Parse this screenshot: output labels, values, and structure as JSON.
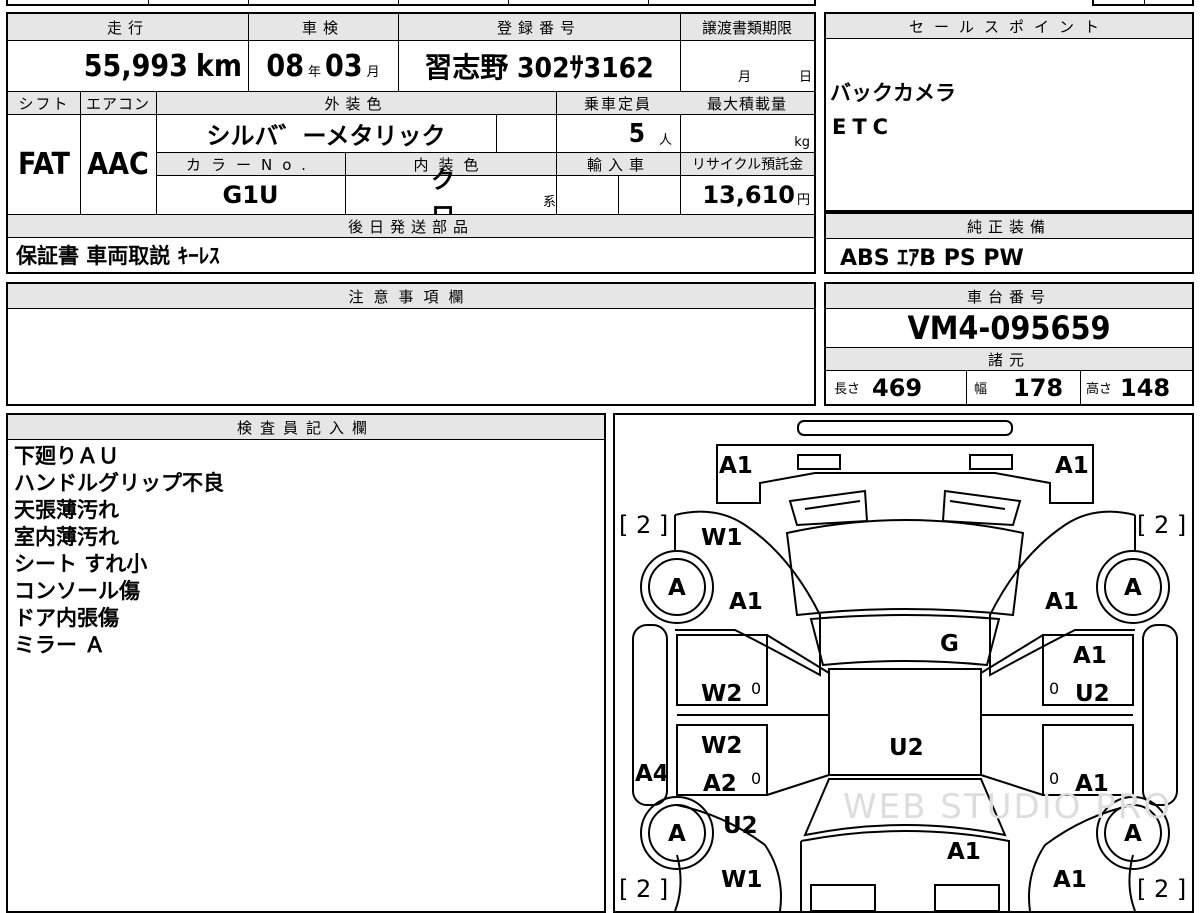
{
  "top": {
    "h_mileage": "走行",
    "mileage": "55,993",
    "mileage_unit": "km",
    "h_inspection": "車検",
    "insp_year": "08",
    "insp_year_unit": "年",
    "insp_month": "03",
    "insp_month_unit": "月",
    "h_registration": "登録番号",
    "registration": "習志野 302ｻ3162",
    "h_transfer": "譲渡書類期限",
    "transfer_month": "月",
    "transfer_day": "日"
  },
  "spec": {
    "h_shift": "シフト",
    "shift": "FAT",
    "h_aircon": "エアコン",
    "aircon": "AAC",
    "h_exterior": "外装色",
    "exterior": "シルバ゛ーメタリック",
    "h_capacity": "乗車定員",
    "capacity": "5",
    "capacity_unit": "人",
    "h_maxload": "最大積載量",
    "maxload_unit": "kg",
    "h_color_no": "カラーNo.",
    "color_no": "G1U",
    "h_interior": "内装色",
    "interior": "クロ",
    "interior_unit": "系",
    "h_import": "輸入車",
    "h_recycle": "リサイクル預託金",
    "recycle": "13,610",
    "recycle_unit": "円"
  },
  "later": {
    "header": "後日発送部品",
    "items": "保証書 車両取説 ｷｰﾚｽ"
  },
  "sales": {
    "header": "セールスポイント",
    "lines": [
      "バックカメラ",
      "ETC"
    ]
  },
  "genuine": {
    "header": "純正装備",
    "items": "ABS ｴｱB PS PW"
  },
  "notes": {
    "header": "注意事項欄"
  },
  "chassis": {
    "header": "車台番号",
    "number": "VM4-095659",
    "spec_header": "諸元",
    "len_label": "長さ",
    "len": "469",
    "wid_label": "幅",
    "wid": "178",
    "hgt_label": "高さ",
    "hgt": "148"
  },
  "inspector": {
    "header": "検査員記入欄",
    "lines": [
      "下廻りＡＵ",
      "ハンドルグリップ不良",
      "天張薄汚れ",
      "室内薄汚れ",
      "シート すれ小",
      "コンソール傷",
      "ドア内張傷",
      "ミラー Ａ"
    ]
  },
  "diagram": {
    "marks": [
      "A1",
      "A1",
      "W1",
      "A",
      "A1",
      "A1",
      "A",
      "G",
      "A1",
      "W2",
      "U2",
      "W2",
      "U2",
      "A4",
      "A2",
      "A1",
      "A",
      "U2",
      "A",
      "A1",
      "W1",
      "A1"
    ],
    "zero": "0",
    "bracket": "[ 2 ]",
    "watermark": "WEB STUDIO PRO"
  }
}
